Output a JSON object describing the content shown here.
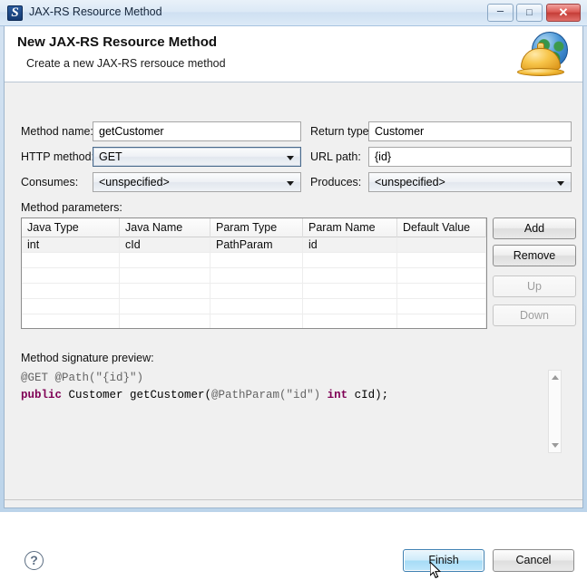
{
  "window": {
    "title": "JAX-RS Resource Method",
    "icon": "jaxrs-icon",
    "controls": {
      "minimize": "–",
      "maximize": "□",
      "close": "✕"
    }
  },
  "banner": {
    "title": "New JAX-RS Resource Method",
    "subtitle": "Create a new JAX-RS rersouce method",
    "icon": "globe-bell-icon"
  },
  "form": {
    "method_name": {
      "label": "Method name:",
      "value": "getCustomer"
    },
    "return_type": {
      "label": "Return type:",
      "value": "Customer"
    },
    "http_method": {
      "label": "HTTP method:",
      "value": "GET"
    },
    "url_path": {
      "label": "URL path:",
      "value": "{id}"
    },
    "consumes": {
      "label": "Consumes:",
      "value": "<unspecified>"
    },
    "produces": {
      "label": "Produces:",
      "value": "<unspecified>"
    }
  },
  "parameters": {
    "label": "Method parameters:",
    "columns": [
      "Java Type",
      "Java Name",
      "Param Type",
      "Param Name",
      "Default Value"
    ],
    "rows": [
      [
        "int",
        "cId",
        "PathParam",
        "id",
        ""
      ]
    ],
    "empty_row_count": 5,
    "buttons": [
      {
        "label": "Add",
        "enabled": true
      },
      {
        "label": "Remove",
        "enabled": true
      },
      {
        "label": "Up",
        "enabled": false
      },
      {
        "label": "Down",
        "enabled": false
      }
    ]
  },
  "preview": {
    "label": "Method signature preview:",
    "line1_annotation": "@GET @Path(\"{id}\")",
    "line2_keyword1": "public",
    "line2_mid": " Customer getCustomer(",
    "line2_annotation": "@PathParam(\"id\")",
    "line2_keyword2": "int",
    "line2_tail": " cId);"
  },
  "footer": {
    "help": "?",
    "finish": "Finish",
    "cancel": "Cancel"
  },
  "colors": {
    "keyword": "#7F0055",
    "annotation": "#646464",
    "dialog_bg": "#F0F0F0",
    "accent": "#3C7FB1"
  }
}
